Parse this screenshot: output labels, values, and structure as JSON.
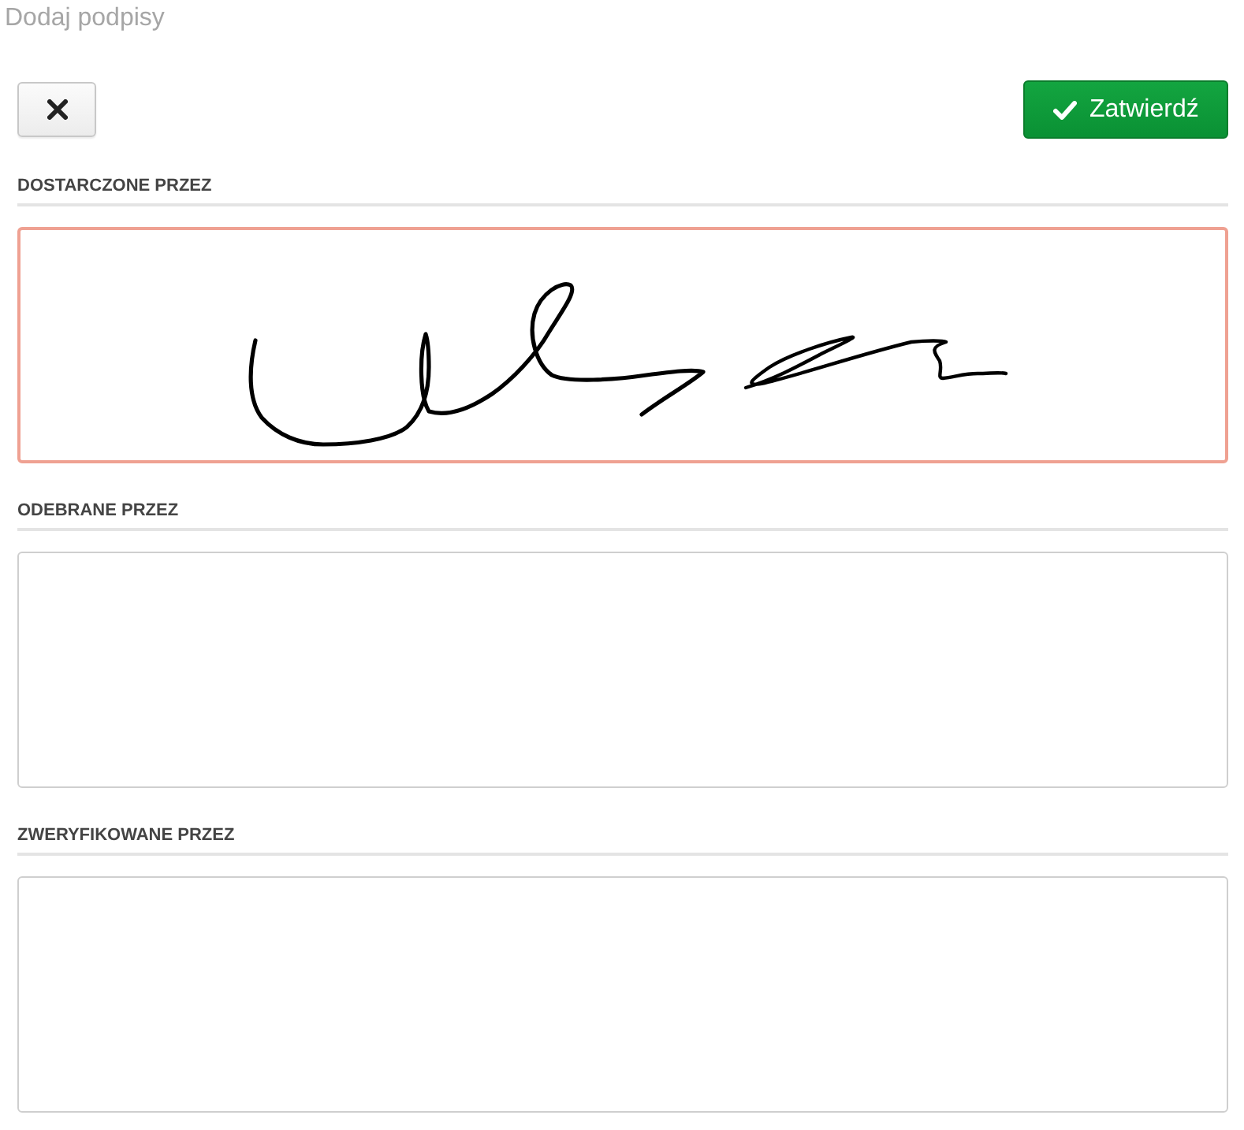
{
  "page": {
    "title": "Dodaj podpisy"
  },
  "toolbar": {
    "buttons": [
      {
        "kind": "close"
      },
      {
        "kind": "confirm",
        "label": "Zatwierdź"
      }
    ]
  },
  "sections": [
    {
      "label": "DOSTARCZONE PRZEZ",
      "signed": true
    },
    {
      "label": "ODEBRANE PRZEZ",
      "signed": false
    },
    {
      "label": "ZWERYFIKOWANE PRZEZ",
      "signed": false
    }
  ]
}
